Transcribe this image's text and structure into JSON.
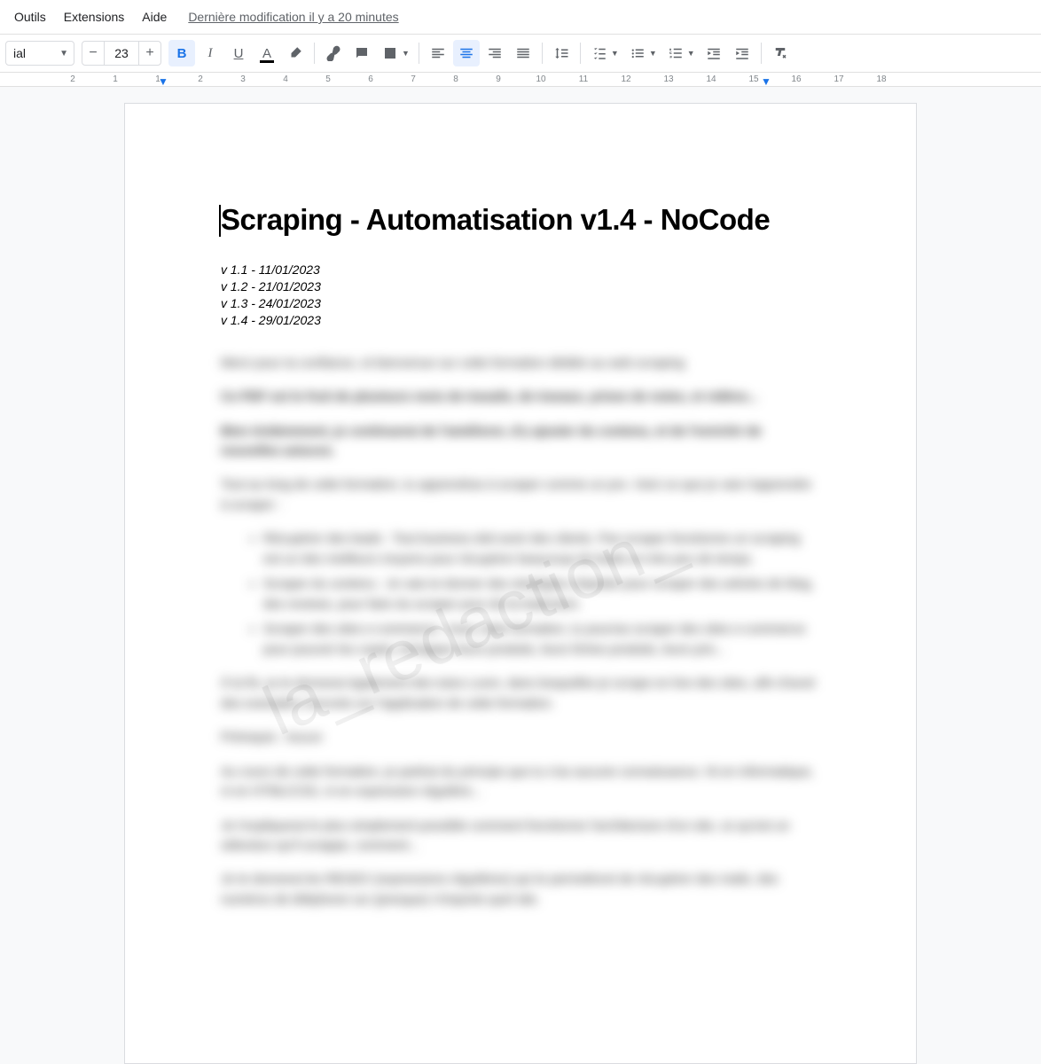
{
  "menubar": {
    "items": [
      "Outils",
      "Extensions",
      "Aide"
    ],
    "last_edit": "Dernière modification il y a 20 minutes"
  },
  "toolbar": {
    "font_name": "ial",
    "font_size": "23",
    "minus": "−",
    "plus": "+"
  },
  "ruler": {
    "numbers": [
      "2",
      "1",
      "1",
      "2",
      "3",
      "4",
      "5",
      "6",
      "7",
      "8",
      "9",
      "10",
      "11",
      "12",
      "13",
      "14",
      "15",
      "16",
      "17",
      "18"
    ]
  },
  "document": {
    "title": "Scraping - Automatisation v1.4 - NoCode",
    "versions": [
      "v 1.1 - 11/01/2023",
      "v 1.2 - 21/01/2023",
      "v 1.3 - 24/01/2023",
      "v 1.4 - 29/01/2023"
    ],
    "blurred_paragraphs": [
      "Merci pour ta confiance, et bienvenue sur cette formation dédiée au web scraping",
      "Ce PDF est le fruit de plusieurs mois de travails, de travaux, prises de notes, et vidéos...",
      "Bien évidemment, je continuerai de l'améliorer, d'y ajouter du contenu, et de l'enrichir de nouvelles astuces.",
      "Tout au long de cette formation, tu apprendras à scraper comme un pro. Voici ce que je vais t'apprendre à scraper :"
    ],
    "blurred_list": [
      "Récupérer des leads : Tout business doit avoir des clients. Pas scraper fonctionne un scraping est un des meilleurs moyens pour récupérer beaucoup de leads en très peu de temps.",
      "Scraper du contenu : Je vais te donner des stratégies chipotée pour scraper des articles de blog, des reviews, pour faire du scraper pour de la traduction.",
      "Scraper des sites e-commerce : Avec cette formation, tu pourras scraper des sites e-commerce pour pouvoir les copier, échapper leurs produits, leurs fiches produits, leurs prix..."
    ],
    "blurred_paragraphs2": [
      "À la fin, je te donnerai également des tutos Loom, dans lesquelles je scrape en live des sites, afin d'avoir des exemples concrets sur l'application de cette formation.",
      "Prérequis : Aucun",
      "Au cours de cette formation, je partirai du principe que tu n'as aucune connaissance. Ni en informatique, ni en HTML/CSS, ni en expression régulière...",
      "Je t'expliquerai le plus simplement possible comment fonctionne l'architecture d'un site, ce qu'est un sélecteur qu'il scrappe, comment...",
      "Je te donnerai les REGEX (expressions régulières) qui te permettront de récupérer des mails, des numéros de téléphone sur (presque) n'importe quel site."
    ],
    "watermark": "la_redaction_"
  }
}
